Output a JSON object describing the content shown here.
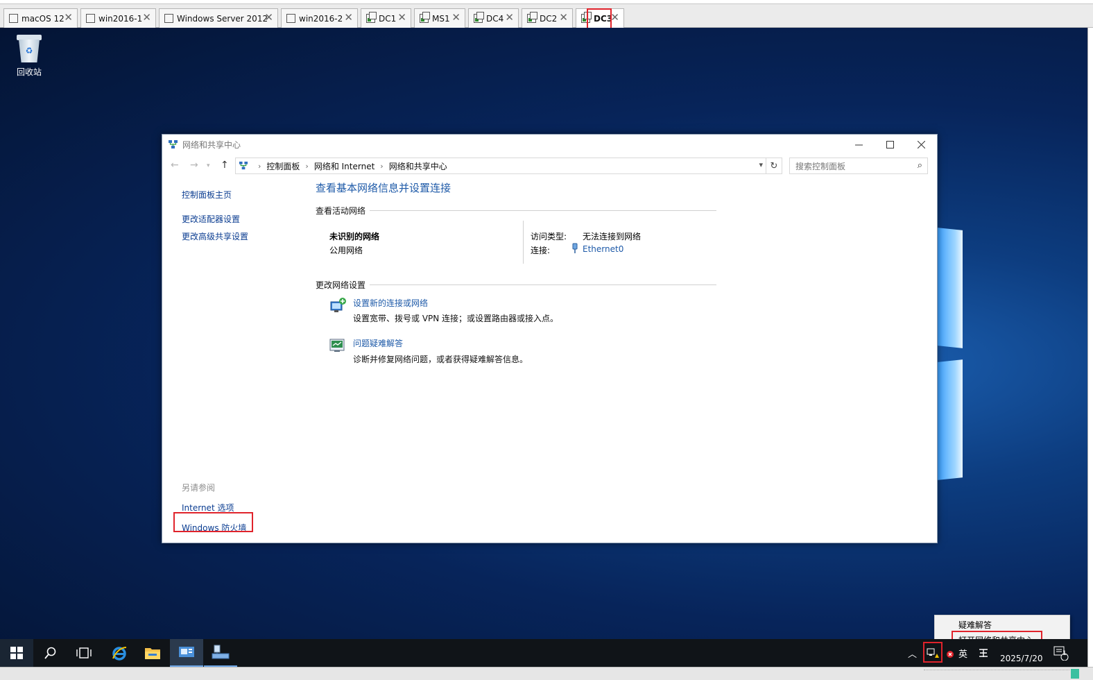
{
  "vm_tabs": [
    {
      "label": "macOS 12",
      "icon": "vm-window-icon"
    },
    {
      "label": "win2016-1",
      "icon": "vm-window-icon"
    },
    {
      "label": "Windows Server 2012",
      "icon": "vm-window-icon"
    },
    {
      "label": "win2016-2",
      "icon": "vm-window-icon"
    },
    {
      "label": "DC1",
      "icon": "vm-running-icon"
    },
    {
      "label": "MS1",
      "icon": "vm-running-icon"
    },
    {
      "label": "DC4",
      "icon": "vm-running-icon"
    },
    {
      "label": "DC2",
      "icon": "vm-running-icon"
    },
    {
      "label": "DC3",
      "icon": "vm-running-icon",
      "active": true
    }
  ],
  "close_glyph": "✕",
  "desktop": {
    "recycle_bin_label": "回收站"
  },
  "window": {
    "title": "网络和共享中心",
    "breadcrumb": [
      "控制面板",
      "网络和 Internet",
      "网络和共享中心"
    ],
    "search_placeholder": "搜索控制面板",
    "left_links": [
      "控制面板主页",
      "更改适配器设置",
      "更改高级共享设置"
    ],
    "see_also": {
      "heading": "另请参阅",
      "links": [
        "Internet 选项",
        "Windows 防火墙"
      ]
    },
    "heading": "查看基本网络信息并设置连接",
    "active_networks_heading": "查看活动网络",
    "network": {
      "name": "未识别的网络",
      "type": "公用网络",
      "access_type_label": "访问类型:",
      "access_type_value": "无法连接到网络",
      "connection_label": "连接:",
      "connection_value": "Ethernet0"
    },
    "change_settings_heading": "更改网络设置",
    "tasks": [
      {
        "link": "设置新的连接或网络",
        "description": "设置宽带、拨号或 VPN 连接；或设置路由器或接入点。"
      },
      {
        "link": "问题疑难解答",
        "description": "诊断并修复网络问题，或者获得疑难解答信息。"
      }
    ]
  },
  "context_menu": {
    "items": [
      "疑难解答",
      "打开网络和共享中心"
    ]
  },
  "taskbar": {
    "ime_label": "英",
    "date": "2025/7/20",
    "notification_count": "1"
  },
  "colors": {
    "link_blue": "#1e5aa8",
    "highlight_red": "#e0232b",
    "taskbar": "#101418"
  }
}
